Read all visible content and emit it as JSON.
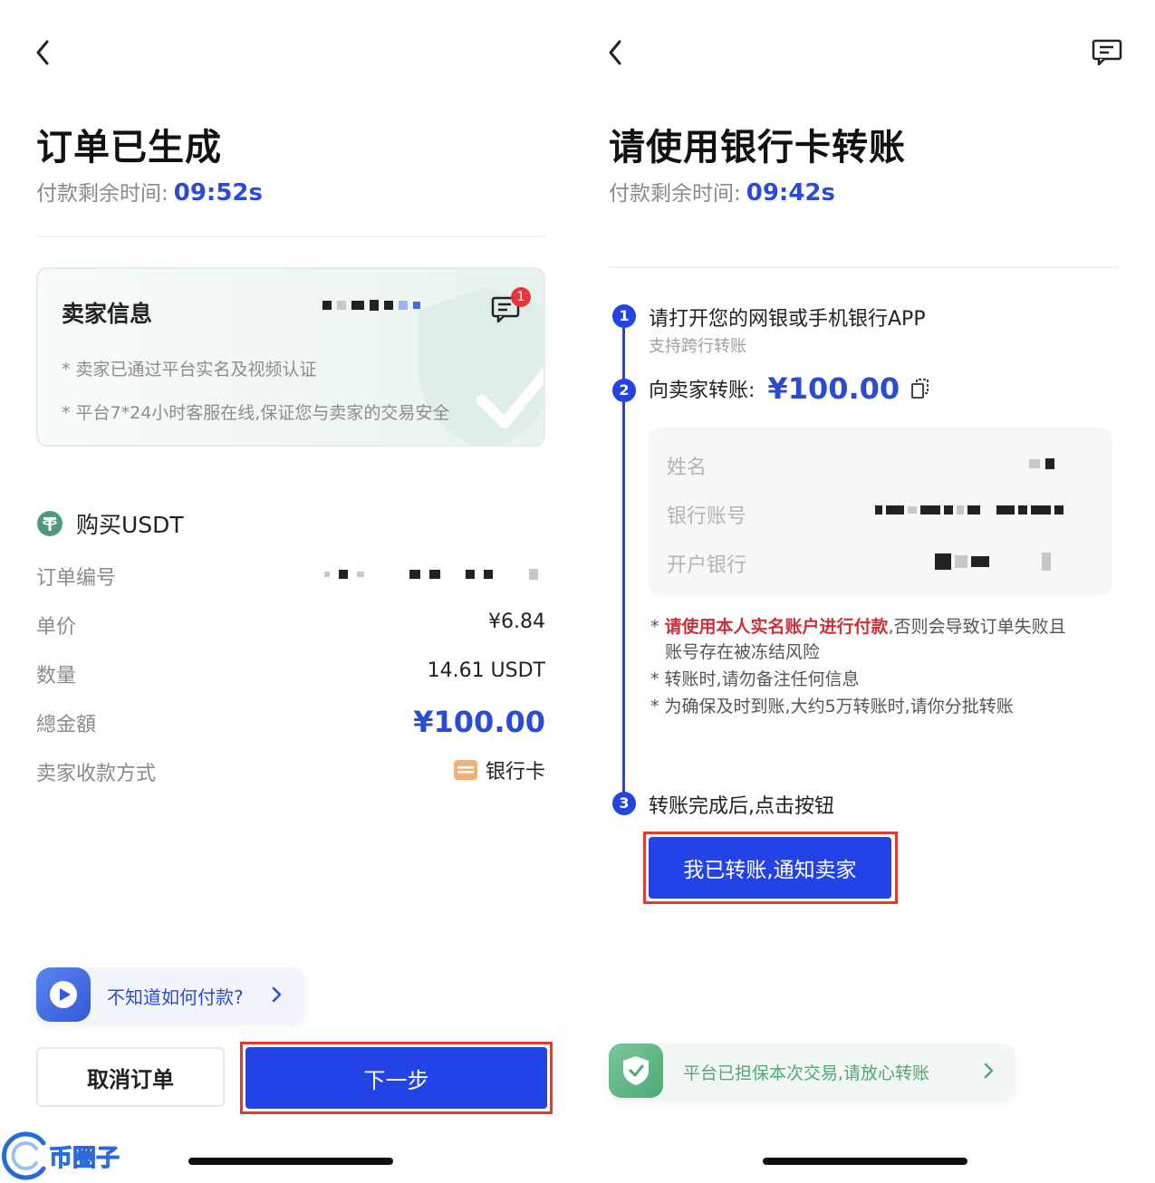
{
  "left": {
    "title": "订单已生成",
    "timer_label": "付款剩余时间:",
    "timer_value": "09:52s",
    "seller_card": {
      "title": "卖家信息",
      "badge": "1",
      "note1": "* 卖家已通过平台实名及视频认证",
      "note2": "* 平台7*24小时客服在线,保证您与卖家的交易安全"
    },
    "order": {
      "heading": "购买USDT",
      "rows": [
        {
          "label": "订单编号",
          "value": ""
        },
        {
          "label": "单价",
          "value": "¥6.84"
        },
        {
          "label": "数量",
          "value": "14.61 USDT"
        },
        {
          "label": "總金額",
          "value": "¥100.00"
        },
        {
          "label": "卖家收款方式",
          "value": "银行卡"
        }
      ]
    },
    "help": "不知道如何付款?",
    "cancel_button": "取消订单",
    "next_button": "下一步"
  },
  "right": {
    "title": "请使用银行卡转账",
    "timer_label": "付款剩余时间:",
    "timer_value": "09:42s",
    "steps": [
      {
        "num": "1",
        "title": "请打开您的网银或手机银行APP",
        "sub": "支持跨行转账"
      },
      {
        "num": "2",
        "title": "向卖家转账:",
        "amount": "¥100.00"
      },
      {
        "num": "3",
        "title": "转账完成后,点击按钮"
      }
    ],
    "bank": {
      "name_label": "姓名",
      "account_label": "银行账号",
      "bank_label": "开户银行"
    },
    "warnings": {
      "w1_red": "请使用本人实名账户进行付款",
      "w1_rest": ",否则会导致订单失败且",
      "w1_line2": "账号存在被冻结风险",
      "w2": "转账时,请勿备注任何信息",
      "w3": "为确保及时到账,大约5万转账时,请你分批转账"
    },
    "notify_button": "我已转账,通知卖家",
    "guarantee": "平台已担保本次交易,请放心转账"
  },
  "watermark": "币圈子",
  "colors": {
    "accent": "#2443e6",
    "timer": "#2a4bd6",
    "highlight": "#e03b2e",
    "warning": "#c8323a",
    "guarantee": "#4caa72"
  }
}
